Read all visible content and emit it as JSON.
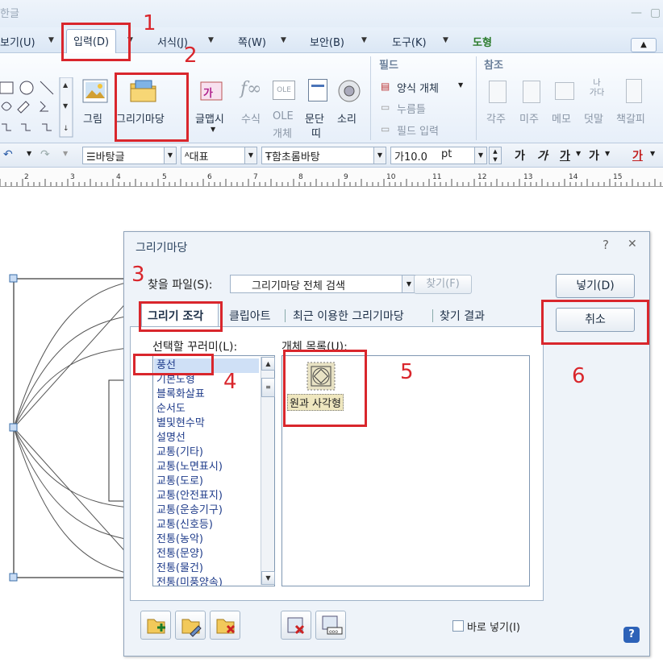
{
  "app": {
    "title_fragment": "한글",
    "menus": [
      {
        "label": "보기(U)"
      },
      {
        "label": "입력(D)"
      },
      {
        "label": "서식(J)"
      },
      {
        "label": "쪽(W)"
      },
      {
        "label": "보안(B)"
      },
      {
        "label": "도구(K)"
      },
      {
        "label": "도형"
      }
    ],
    "ribbon": {
      "insert_image": "그림",
      "drawing_gallery": "그리기마당",
      "wordart": "글맵시",
      "formula": "수식",
      "ole_1": "OLE",
      "ole_2": "개체",
      "paragraph_1": "문단",
      "paragraph_2": "띠",
      "sound": "소리",
      "field_group": "필드",
      "form_object": "양식 개체",
      "click_here": "누름틀",
      "field_input": "필드 입력",
      "reference_group": "참조",
      "footnote": "각주",
      "endnote": "미주",
      "memo": "메모",
      "ruby": "덧말",
      "bookmark": "책갈피",
      "ruby_icon_top": "나",
      "ruby_icon_bottom": "가다",
      "ole_icon": "OLE"
    },
    "formatbar": {
      "style": "바탕글",
      "lang": "대표",
      "font": "함초롬바탕",
      "size": "10.0",
      "size_unit": "pt",
      "b1": "가",
      "b2": "가",
      "b3": "가",
      "b4": "가",
      "b5": "가"
    },
    "ruler_numbers": [
      "2",
      "3",
      "4",
      "5",
      "6",
      "7",
      "8",
      "9",
      "10",
      "11",
      "12",
      "13",
      "14",
      "15"
    ]
  },
  "dialog": {
    "title": "그리기마당",
    "help": "?",
    "close": "✕",
    "find_file_label": "찾을 파일(S):",
    "find_file_value": "그리기마당 전체 검색",
    "find_button": "찾기(F)",
    "insert_button": "넣기(D)",
    "cancel_button": "취소",
    "tabs": [
      "그리기 조각",
      "클립아트",
      "최근 이용한 그리기마당",
      "찾기 결과"
    ],
    "category_label": "선택할 꾸러미(L):",
    "object_label": "개체 목록(U):",
    "categories": [
      "풍선",
      "기본도형",
      "블록화살표",
      "순서도",
      "별및현수막",
      "설명선",
      "교통(기타)",
      "교통(노면표시)",
      "교통(도로)",
      "교통(안전표지)",
      "교통(운송기구)",
      "교통(신호등)",
      "전통(농악)",
      "전통(문양)",
      "전통(물건)",
      "전통(미풍양속)"
    ],
    "objects": [
      {
        "label": "원과 사각형"
      }
    ],
    "direct_insert_label": "바로 넣기(I)"
  },
  "annotations": [
    "1",
    "2",
    "3",
    "4",
    "5",
    "6"
  ],
  "colors": {
    "annotation_red": "#d9262c",
    "accent_blue": "#1e3b8a"
  }
}
